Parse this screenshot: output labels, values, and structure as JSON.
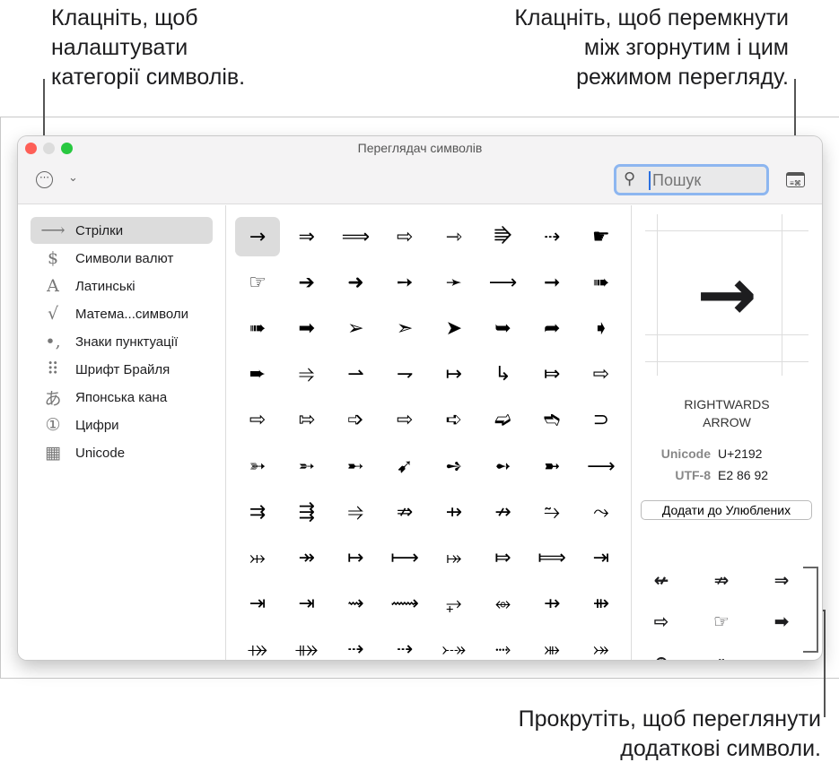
{
  "callouts": {
    "customize": "Клацніть, щоб\nналаштувати\nкатегорії символів.",
    "toggle": "Клацніть, щоб перемкнути\nміж згорнутим і цим\nрежимом перегляду.",
    "scroll": "Прокрутіть, щоб переглянути\nдодаткові символи."
  },
  "window": {
    "title": "Переглядач символів",
    "colors": {
      "close": "#fe5f57",
      "minimize": "#dcdcdc",
      "zoom": "#28c840"
    }
  },
  "toolbar": {
    "more": "⋯",
    "chevron": "⌄",
    "search_placeholder": "Пошук",
    "search_value": "",
    "search_icon": "⚲",
    "toggle_icon": "≡⌘"
  },
  "sidebar": {
    "items": [
      {
        "icon": "⟶",
        "label": "Стрілки",
        "selected": true
      },
      {
        "icon": "$",
        "label": "Символи валют"
      },
      {
        "icon": "A",
        "label": "Латинські"
      },
      {
        "icon": "√",
        "label": "Матема...символи"
      },
      {
        "icon": "•,",
        "label": "Знаки пунктуації"
      },
      {
        "icon": "⠿",
        "label": "Шрифт Брайля"
      },
      {
        "icon": "あ",
        "label": "Японська кана"
      },
      {
        "icon": "①",
        "label": "Цифри"
      },
      {
        "icon": "▦",
        "label": "Unicode"
      }
    ]
  },
  "grid": [
    [
      "→",
      "⇒",
      "⟹",
      "⇨",
      "⇾",
      "⭆",
      "⇢",
      "☛"
    ],
    [
      "☞",
      "➔",
      "➜",
      "➙",
      "➛",
      "⟶",
      "➞",
      "➠"
    ],
    [
      "➠",
      "➡",
      "➢",
      "➣",
      "➤",
      "➥",
      "➦",
      "➧"
    ],
    [
      "➨",
      "⥤",
      "⇀",
      "⇁",
      "↦",
      "↳",
      "⤇",
      "⇨"
    ],
    [
      "⇨",
      "⇰",
      "➩",
      "⇨",
      "➪",
      "➫",
      "➬",
      "⊃"
    ],
    [
      "➳",
      "➵",
      "➸",
      "➹",
      "➺",
      "➻",
      "➼",
      "⟶"
    ],
    [
      "⇉",
      "⇶",
      "⥤",
      "⇏",
      "⇸",
      "↛",
      "⥲",
      "⤳"
    ],
    [
      "⤔",
      "↠",
      "↦",
      "⟼",
      "⤅",
      "⤇",
      "⟾",
      "⇥"
    ],
    [
      "⇥",
      "⇥",
      "⇝",
      "⟿",
      "⥅",
      "⥈",
      "⇸",
      "⇻"
    ],
    [
      "⤀",
      "⤁",
      "⇢",
      "⇢",
      "⤐",
      "⤑",
      "⤕",
      "⤖"
    ]
  ],
  "detail": {
    "char": "→",
    "name": "RIGHTWARDS\nARROW",
    "unicode_label": "Unicode",
    "unicode": "U+2192",
    "utf8_label": "UTF-8",
    "utf8": "E2 86 92",
    "add_favorites": "Додати до Улюблених"
  },
  "favorites": [
    [
      "↚",
      "⇏",
      "⇒"
    ],
    [
      "⇨",
      "☞",
      "➡"
    ],
    [
      "⊕",
      "⟛",
      ""
    ]
  ]
}
